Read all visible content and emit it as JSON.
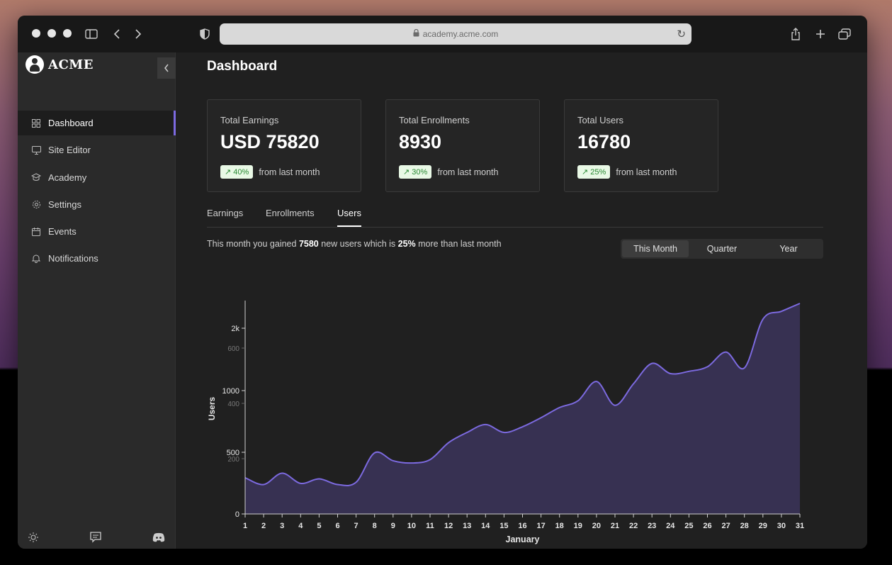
{
  "browser": {
    "url": "academy.acme.com"
  },
  "sidebar": {
    "logo_text": "ACME",
    "items": [
      {
        "label": "Dashboard",
        "icon": "grid-icon",
        "active": true
      },
      {
        "label": "Site Editor",
        "icon": "monitor-icon",
        "active": false
      },
      {
        "label": "Academy",
        "icon": "graduation-cap-icon",
        "active": false
      },
      {
        "label": "Settings",
        "icon": "gear-icon",
        "active": false
      },
      {
        "label": "Events",
        "icon": "calendar-icon",
        "active": false
      },
      {
        "label": "Notifications",
        "icon": "bell-icon",
        "active": false
      }
    ],
    "footer_icons": [
      "sun-icon",
      "chat-icon",
      "discord-icon"
    ]
  },
  "main": {
    "title": "Dashboard",
    "cards": [
      {
        "label": "Total Earnings",
        "value": "USD 75820",
        "badge": "40%",
        "suffix": "from last month"
      },
      {
        "label": "Total Enrollments",
        "value": "8930",
        "badge": "30%",
        "suffix": "from last month"
      },
      {
        "label": "Total Users",
        "value": "16780",
        "badge": "25%",
        "suffix": "from last month"
      }
    ],
    "tabs": [
      {
        "label": "Earnings",
        "active": false
      },
      {
        "label": "Enrollments",
        "active": false
      },
      {
        "label": "Users",
        "active": true
      }
    ],
    "gain": {
      "prefix": "This month you gained ",
      "count": "7580",
      "middle": " new users which is ",
      "percent": "25%",
      "suffix": " more than last month"
    },
    "periods": [
      {
        "label": "This Month",
        "active": true
      },
      {
        "label": "Quarter",
        "active": false
      },
      {
        "label": "Year",
        "active": false
      }
    ]
  },
  "colors": {
    "accent": "#7c6ae0",
    "area_fill": "#373152",
    "badge_bg": "#e9f9e6",
    "badge_text": "#2a8a34"
  },
  "chart_data": {
    "type": "area",
    "x": [
      1,
      2,
      3,
      4,
      5,
      6,
      7,
      8,
      9,
      10,
      11,
      12,
      13,
      14,
      15,
      16,
      17,
      18,
      19,
      20,
      21,
      22,
      23,
      24,
      25,
      26,
      27,
      28,
      29,
      30,
      31
    ],
    "series": [
      {
        "values": [
          320,
          260,
          360,
          270,
          310,
          260,
          280,
          540,
          470,
          450,
          480,
          630,
          720,
          790,
          720,
          770,
          850,
          940,
          1000,
          1170,
          960,
          1150,
          1330,
          1240,
          1260,
          1300,
          1430,
          1290,
          1720,
          1790,
          1860
        ]
      }
    ],
    "xlabel": "January",
    "ylabel": "Users",
    "yticks_major": [
      "0",
      "500",
      "1000",
      "2k"
    ],
    "yticks_minor": [
      "200",
      "400",
      "600"
    ],
    "ylim": [
      0,
      1860
    ],
    "grid": false
  }
}
